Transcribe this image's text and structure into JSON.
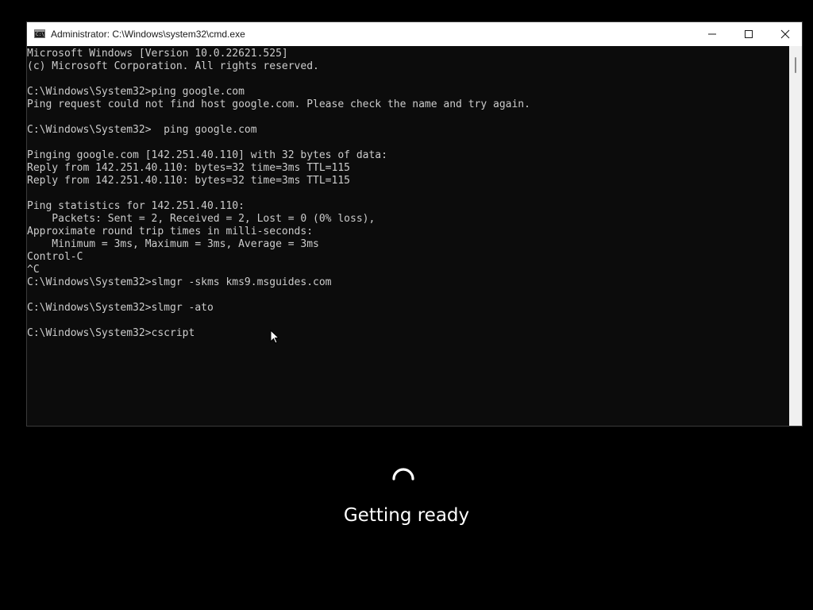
{
  "window": {
    "title": "Administrator: C:\\Windows\\system32\\cmd.exe",
    "icon": "cmd-icon",
    "controls": [
      "minimize-icon",
      "maximize-icon",
      "close-icon"
    ]
  },
  "console": {
    "lines": [
      "Microsoft Windows [Version 10.0.22621.525]",
      "(c) Microsoft Corporation. All rights reserved.",
      "",
      "C:\\Windows\\System32>ping google.com",
      "Ping request could not find host google.com. Please check the name and try again.",
      "",
      "C:\\Windows\\System32>  ping google.com",
      "",
      "Pinging google.com [142.251.40.110] with 32 bytes of data:",
      "Reply from 142.251.40.110: bytes=32 time=3ms TTL=115",
      "Reply from 142.251.40.110: bytes=32 time=3ms TTL=115",
      "",
      "Ping statistics for 142.251.40.110:",
      "    Packets: Sent = 2, Received = 2, Lost = 0 (0% loss),",
      "Approximate round trip times in milli-seconds:",
      "    Minimum = 3ms, Maximum = 3ms, Average = 3ms",
      "Control-C",
      "^C",
      "C:\\Windows\\System32>slmgr -skms kms9.msguides.com",
      "",
      "C:\\Windows\\System32>slmgr -ato",
      "",
      "C:\\Windows\\System32>cscript"
    ]
  },
  "status": {
    "text": "Getting ready",
    "icon": "loading-spinner-icon"
  },
  "colors": {
    "console_background": "#0c0c0c",
    "console_text": "#cccccc",
    "screen_background": "#000000",
    "titlebar_background": "#ffffff"
  }
}
